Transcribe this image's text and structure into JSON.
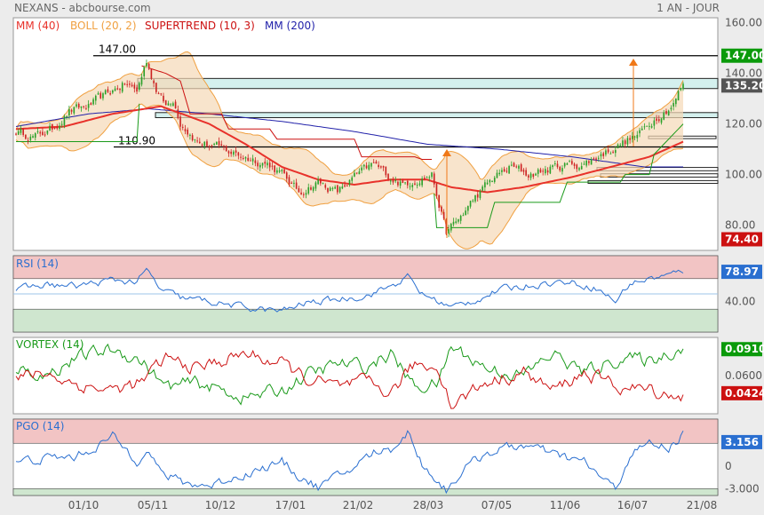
{
  "header": {
    "title": "NEXANS - abcbourse.com",
    "period": "1 AN - JOUR"
  },
  "colors": {
    "bg": "#ececec",
    "panel": "#ffffff",
    "mm40": "#e8322b",
    "boll": "#f0a040",
    "bollFill": "#f5d9b6",
    "supertrend": "#cc1111",
    "mm200": "#2222aa",
    "rsi": "#2a6fd0",
    "vortexPlus": "#1a9a1a",
    "vortexMinus": "#cc1111",
    "pgo": "#2a6fd0",
    "upCandle": "#2aa02a",
    "downCandle": "#cc2222",
    "zoneRed": "#f2c4c4",
    "zoneGreen": "#cfe6cf",
    "zoneCyan": "#d4f0ee",
    "arrow": "#f07818"
  },
  "price_legend": [
    {
      "label": "MM (40)",
      "color": "#e8322b"
    },
    {
      "label": "BOLL (20, 2)",
      "color": "#f0a040"
    },
    {
      "label": "SUPERTREND (10, 3)",
      "color": "#cc1111"
    },
    {
      "label": "MM (200)",
      "color": "#2222aa"
    }
  ],
  "price_labels": {
    "high": "147.00",
    "support": "110.90"
  },
  "badges": {
    "price_high": {
      "text": "147.00",
      "value": 147,
      "bg": "#0a9a0a"
    },
    "price_last": {
      "text": "135.20",
      "value": 135.2,
      "bg": "#555555"
    },
    "price_low": {
      "text": "74.40",
      "value": 74.4,
      "bg": "#cc1111"
    },
    "rsi": {
      "text": "78.97",
      "value": 78.97,
      "bg": "#2a6fd0"
    },
    "vortex_plus": {
      "text": "0.0910",
      "value": 1.18,
      "bg": "#0a9a0a"
    },
    "vortex_minus": {
      "text": "0.0424",
      "value": 0.88,
      "bg": "#cc1111"
    },
    "pgo": {
      "text": "3.156",
      "value": 3.156,
      "bg": "#2a6fd0"
    }
  },
  "x_labels": [
    "01/10",
    "05/11",
    "10/12",
    "17/01",
    "21/02",
    "28/03",
    "07/05",
    "11/06",
    "16/07",
    "21/08"
  ],
  "chart_data": [
    {
      "type": "candlestick",
      "name": "price",
      "ylim": [
        70,
        162
      ],
      "yticks": [
        {
          "v": 80,
          "t": "80.00"
        },
        {
          "v": 100,
          "t": "100.00"
        },
        {
          "v": 120,
          "t": "120.00"
        },
        {
          "v": 140,
          "t": "140.00"
        },
        {
          "v": 160,
          "t": "160.00"
        }
      ],
      "n_days": 250,
      "keypoints": [
        [
          0,
          117
        ],
        [
          8,
          115
        ],
        [
          15,
          118
        ],
        [
          22,
          125
        ],
        [
          30,
          127
        ],
        [
          38,
          132
        ],
        [
          45,
          136
        ],
        [
          50,
          133
        ],
        [
          54,
          145
        ],
        [
          58,
          134
        ],
        [
          62,
          127
        ],
        [
          65,
          130
        ],
        [
          68,
          121
        ],
        [
          75,
          113
        ],
        [
          85,
          110
        ],
        [
          95,
          107
        ],
        [
          105,
          104
        ],
        [
          110,
          100
        ],
        [
          117,
          93
        ],
        [
          125,
          97
        ],
        [
          133,
          93
        ],
        [
          140,
          99
        ],
        [
          148,
          104
        ],
        [
          155,
          99
        ],
        [
          160,
          96
        ],
        [
          165,
          98
        ],
        [
          172,
          100
        ],
        [
          178,
          77
        ],
        [
          183,
          82
        ],
        [
          190,
          91
        ],
        [
          198,
          99
        ],
        [
          205,
          103
        ],
        [
          212,
          100
        ],
        [
          220,
          102
        ],
        [
          228,
          104
        ],
        [
          235,
          104
        ],
        [
          242,
          108
        ],
        [
          250,
          112
        ],
        [
          258,
          116
        ],
        [
          265,
          123
        ],
        [
          272,
          128
        ],
        [
          276,
          136
        ]
      ],
      "mm40_keypoints": [
        [
          0,
          118
        ],
        [
          20,
          119
        ],
        [
          40,
          124
        ],
        [
          60,
          127
        ],
        [
          80,
          120
        ],
        [
          95,
          112
        ],
        [
          110,
          103
        ],
        [
          125,
          98
        ],
        [
          140,
          96
        ],
        [
          155,
          98
        ],
        [
          170,
          98
        ],
        [
          180,
          95
        ],
        [
          195,
          93
        ],
        [
          210,
          95
        ],
        [
          230,
          99
        ],
        [
          250,
          104
        ],
        [
          262,
          107
        ],
        [
          276,
          113
        ]
      ],
      "mm200_keypoints": [
        [
          0,
          119
        ],
        [
          30,
          124
        ],
        [
          55,
          126
        ],
        [
          80,
          124
        ],
        [
          110,
          121
        ],
        [
          140,
          117
        ],
        [
          170,
          112
        ],
        [
          200,
          110
        ],
        [
          230,
          107
        ],
        [
          260,
          103
        ],
        [
          276,
          103
        ]
      ],
      "supertrend_keypoints": [
        [
          0,
          113
        ],
        [
          50,
          113
        ],
        [
          52,
          143
        ],
        [
          62,
          140
        ],
        [
          68,
          137
        ],
        [
          72,
          124
        ],
        [
          85,
          124
        ],
        [
          88,
          118
        ],
        [
          105,
          118
        ],
        [
          108,
          114
        ],
        [
          140,
          114
        ],
        [
          143,
          107
        ],
        [
          165,
          107
        ],
        [
          168,
          106
        ],
        [
          172,
          106
        ],
        [
          174,
          79
        ],
        [
          195,
          79
        ],
        [
          198,
          89
        ],
        [
          225,
          89
        ],
        [
          228,
          97
        ],
        [
          250,
          97
        ],
        [
          252,
          100
        ],
        [
          262,
          100
        ],
        [
          264,
          108
        ],
        [
          276,
          120
        ]
      ],
      "hlines": [
        {
          "value": 147,
          "from": 105,
          "to": 808
        },
        {
          "value": 110.9,
          "from": 128,
          "to": 808
        }
      ],
      "zones": [
        {
          "y1": 134,
          "y2": 138,
          "from": 155,
          "to": 808,
          "color": "#d4f0ee"
        },
        {
          "y1": 122.5,
          "y2": 124.5,
          "from": 175,
          "to": 808,
          "color": "#d4f0ee"
        },
        {
          "y1": 114.2,
          "y2": 115.2,
          "from": 730,
          "to": 806,
          "color": "#ffffff"
        },
        {
          "y1": 101.5,
          "y2": 102.8,
          "from": 672,
          "to": 808,
          "color": "#ffffff"
        },
        {
          "y1": 99,
          "y2": 100.3,
          "from": 676,
          "to": 808,
          "color": "#ffffff"
        },
        {
          "y1": 96.5,
          "y2": 97.6,
          "from": 662,
          "to": 808,
          "color": "#ffffff"
        }
      ],
      "arrows": [
        {
          "x": 503,
          "from": 76,
          "to": 112
        },
        {
          "x": 713,
          "from": 113,
          "to": 152
        }
      ]
    },
    {
      "type": "line",
      "name": "rsi",
      "ylim": [
        0,
        100
      ],
      "yticks": [
        {
          "v": 40,
          "t": "40.00"
        }
      ],
      "bands": [
        {
          "from": 70,
          "to": 100,
          "color": "#f2c4c4"
        },
        {
          "from": 0,
          "to": 30,
          "color": "#cfe6cf"
        }
      ],
      "midline": 50,
      "keypoints": [
        [
          0,
          55
        ],
        [
          12,
          62
        ],
        [
          25,
          60
        ],
        [
          40,
          68
        ],
        [
          50,
          66
        ],
        [
          54,
          80
        ],
        [
          60,
          55
        ],
        [
          68,
          45
        ],
        [
          80,
          40
        ],
        [
          95,
          32
        ],
        [
          110,
          27
        ],
        [
          120,
          38
        ],
        [
          133,
          43
        ],
        [
          145,
          48
        ],
        [
          155,
          60
        ],
        [
          162,
          72
        ],
        [
          168,
          50
        ],
        [
          175,
          40
        ],
        [
          180,
          32
        ],
        [
          190,
          42
        ],
        [
          200,
          55
        ],
        [
          215,
          63
        ],
        [
          228,
          66
        ],
        [
          240,
          58
        ],
        [
          248,
          40
        ],
        [
          254,
          64
        ],
        [
          262,
          70
        ],
        [
          270,
          74
        ],
        [
          276,
          80
        ]
      ]
    },
    {
      "type": "line",
      "name": "vortex",
      "ylim": [
        0.74,
        1.26
      ],
      "yticks": [
        {
          "v": 1.0,
          "t": "0.0600"
        }
      ],
      "series": [
        {
          "name": "VI+",
          "color": "#1a9a1a",
          "keypoints": [
            [
              0,
              1.05
            ],
            [
              12,
              1.0
            ],
            [
              25,
              1.12
            ],
            [
              40,
              1.18
            ],
            [
              52,
              1.1
            ],
            [
              62,
              0.92
            ],
            [
              75,
              0.95
            ],
            [
              95,
              0.85
            ],
            [
              110,
              0.9
            ],
            [
              120,
              1.0
            ],
            [
              133,
              1.08
            ],
            [
              145,
              1.06
            ],
            [
              155,
              1.15
            ],
            [
              165,
              0.92
            ],
            [
              175,
              0.95
            ],
            [
              180,
              1.2
            ],
            [
              195,
              1.05
            ],
            [
              210,
              1.0
            ],
            [
              222,
              1.15
            ],
            [
              235,
              1.02
            ],
            [
              250,
              1.12
            ],
            [
              262,
              1.1
            ],
            [
              276,
              1.2
            ]
          ]
        },
        {
          "name": "VI-",
          "color": "#cc1111",
          "keypoints": [
            [
              0,
              0.98
            ],
            [
              12,
              1.02
            ],
            [
              25,
              0.94
            ],
            [
              40,
              0.9
            ],
            [
              52,
              0.95
            ],
            [
              62,
              1.12
            ],
            [
              75,
              1.05
            ],
            [
              95,
              1.15
            ],
            [
              110,
              1.08
            ],
            [
              120,
              0.98
            ],
            [
              133,
              0.92
            ],
            [
              145,
              0.95
            ],
            [
              155,
              0.88
            ],
            [
              165,
              1.08
            ],
            [
              175,
              1.05
            ],
            [
              180,
              0.8
            ],
            [
              195,
              0.96
            ],
            [
              210,
              1.02
            ],
            [
              222,
              0.9
            ],
            [
              235,
              1.02
            ],
            [
              250,
              0.92
            ],
            [
              262,
              0.9
            ],
            [
              276,
              0.86
            ]
          ]
        }
      ]
    },
    {
      "type": "line",
      "name": "pgo",
      "ylim": [
        -3.9,
        6.2
      ],
      "yticks": [
        {
          "v": 0,
          "t": "0"
        },
        {
          "v": -3,
          "t": "-3.000"
        }
      ],
      "bands": [
        {
          "from": 3,
          "to": 6.2,
          "color": "#f2c4c4"
        },
        {
          "from": -3.9,
          "to": -3,
          "color": "#cfe6cf"
        }
      ],
      "keypoints": [
        [
          0,
          0.5
        ],
        [
          12,
          1.0
        ],
        [
          25,
          1.2
        ],
        [
          40,
          3.8
        ],
        [
          50,
          0.8
        ],
        [
          54,
          2.6
        ],
        [
          60,
          -1.0
        ],
        [
          70,
          -2.3
        ],
        [
          80,
          -2.6
        ],
        [
          95,
          -1.0
        ],
        [
          110,
          0.5
        ],
        [
          118,
          -1.5
        ],
        [
          125,
          -2.8
        ],
        [
          135,
          -1.2
        ],
        [
          148,
          1.8
        ],
        [
          155,
          2.2
        ],
        [
          162,
          4.5
        ],
        [
          168,
          0.3
        ],
        [
          178,
          -3.2
        ],
        [
          185,
          -0.5
        ],
        [
          195,
          1.8
        ],
        [
          210,
          2.8
        ],
        [
          222,
          1.5
        ],
        [
          235,
          0.5
        ],
        [
          248,
          -3.2
        ],
        [
          254,
          1.5
        ],
        [
          262,
          2.9
        ],
        [
          270,
          2.4
        ],
        [
          276,
          4.2
        ]
      ]
    }
  ],
  "legends": {
    "rsi": "RSI (14)",
    "vortex": "VORTEX (14)",
    "pgo": "PGO (14)"
  }
}
